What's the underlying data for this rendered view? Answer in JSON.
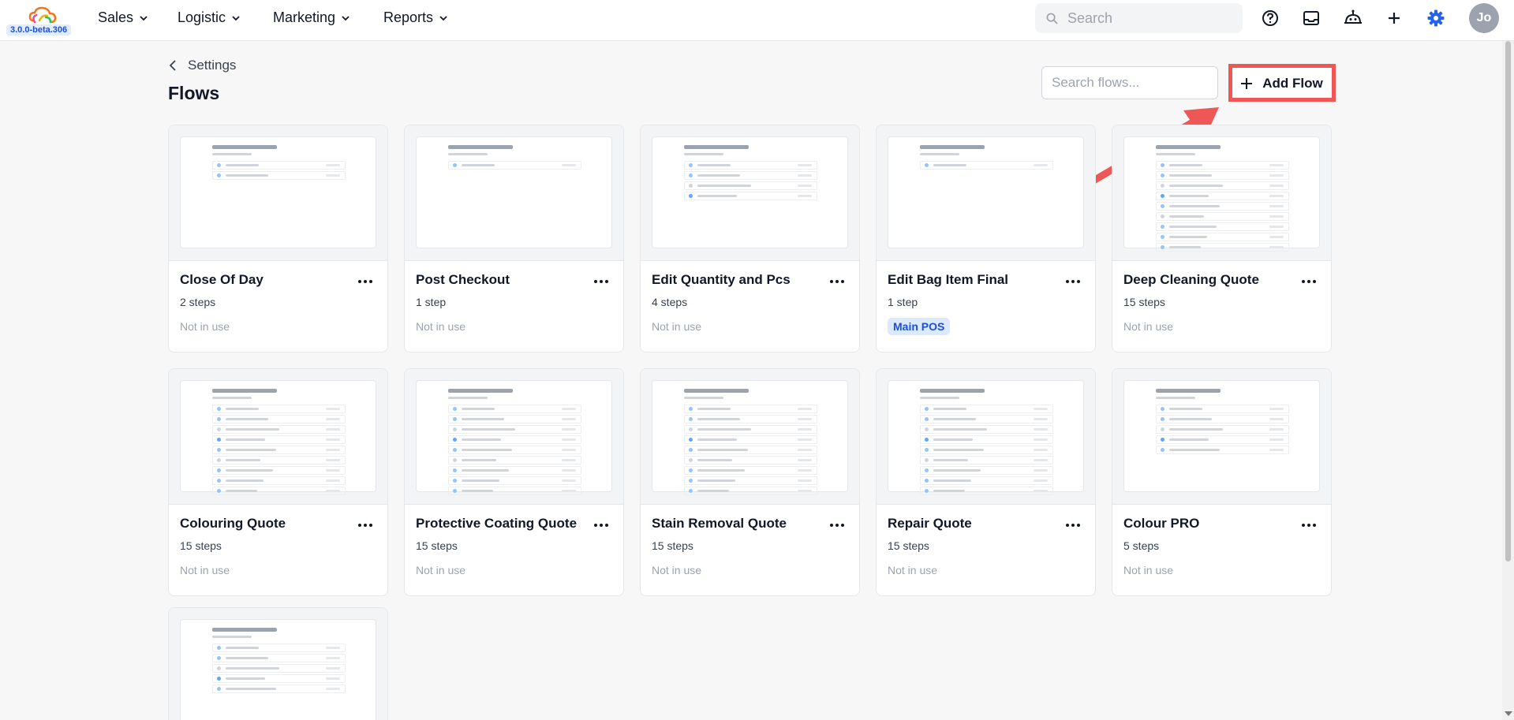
{
  "app": {
    "version": "3.0.0-beta.306",
    "nav": [
      {
        "label": "Sales"
      },
      {
        "label": "Logistic"
      },
      {
        "label": "Marketing"
      },
      {
        "label": "Reports"
      }
    ],
    "search_placeholder": "Search",
    "avatar_initials": "Jo",
    "accent_color": "#2563eb"
  },
  "page": {
    "breadcrumb": "Settings",
    "title": "Flows",
    "search_placeholder": "Search flows...",
    "add_button": "Add Flow",
    "annotation_color": "#ef5656"
  },
  "flows": [
    {
      "name": "Close Of Day",
      "steps": "2 steps",
      "status": "Not in use",
      "preview_rows": 2
    },
    {
      "name": "Post Checkout",
      "steps": "1 step",
      "status": "Not in use",
      "preview_rows": 1
    },
    {
      "name": "Edit Quantity and Pcs",
      "steps": "4 steps",
      "status": "Not in use",
      "preview_rows": 4
    },
    {
      "name": "Edit Bag Item Final",
      "steps": "1 step",
      "badge": "Main POS",
      "preview_rows": 1
    },
    {
      "name": "Deep Cleaning Quote",
      "steps": "15 steps",
      "status": "Not in use",
      "preview_rows": 9
    },
    {
      "name": "Colouring Quote",
      "steps": "15 steps",
      "status": "Not in use",
      "preview_rows": 9
    },
    {
      "name": "Protective Coating Quote",
      "steps": "15 steps",
      "status": "Not in use",
      "preview_rows": 9
    },
    {
      "name": "Stain Removal Quote",
      "steps": "15 steps",
      "status": "Not in use",
      "preview_rows": 9
    },
    {
      "name": "Repair Quote",
      "steps": "15 steps",
      "status": "Not in use",
      "preview_rows": 9
    },
    {
      "name": "Colour PRO",
      "steps": "5 steps",
      "status": "Not in use",
      "preview_rows": 5
    },
    {
      "preview_rows": 5
    }
  ]
}
